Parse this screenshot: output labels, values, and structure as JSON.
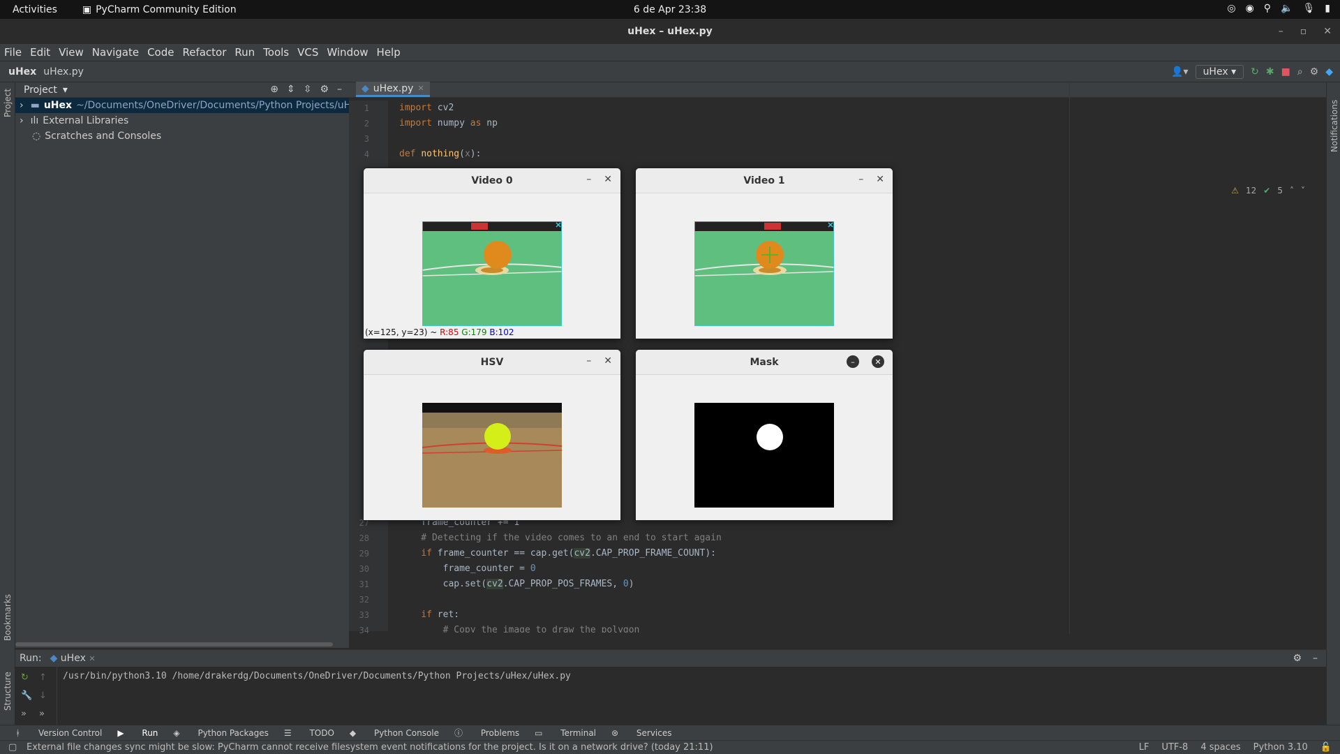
{
  "topbar": {
    "activities": "Activities",
    "app_name": "PyCharm Community Edition",
    "clock": "6 de Apr  23:38"
  },
  "window": {
    "title": "uHex – uHex.py"
  },
  "menu": [
    "File",
    "Edit",
    "View",
    "Navigate",
    "Code",
    "Refactor",
    "Run",
    "Tools",
    "VCS",
    "Window",
    "Help"
  ],
  "breadcrumb": {
    "project": "uHex",
    "file": "uHex.py"
  },
  "run_config": "uHex",
  "project_panel": {
    "title": "Project",
    "tree": [
      {
        "name": "uHex",
        "path": "~/Documents/OneDriver/Documents/Python Projects/uH"
      },
      {
        "name": "External Libraries"
      },
      {
        "name": "Scratches and Consoles"
      }
    ]
  },
  "editor": {
    "tab": "uHex.py",
    "inspections": {
      "warnings": "12",
      "ok": "5"
    },
    "line_numbers_top": [
      "1",
      "2",
      "3",
      "4"
    ],
    "line_numbers_bottom": [
      "27",
      "28",
      "29",
      "30",
      "31",
      "32",
      "33",
      "34"
    ],
    "code_top": [
      "import cv2",
      "import numpy as np",
      "",
      "def nothing(x):"
    ],
    "code_bottom": [
      "    frame_counter += 1",
      "    # Detecting if the video comes to an end to start again",
      "    if frame_counter == cap.get(cv2.CAP_PROP_FRAME_COUNT):",
      "        frame_counter = 0",
      "        cap.set(cv2.CAP_PROP_POS_FRAMES, 0)",
      "",
      "    if ret:",
      "        # Copy the image to draw the polygon"
    ]
  },
  "cv_windows": [
    {
      "title": "Video 0",
      "status": {
        "pos": "(x=125, y=23) ~ ",
        "r": "R:85",
        "g": "G:179",
        "b": "B:102"
      }
    },
    {
      "title": "Video 1"
    },
    {
      "title": "HSV"
    },
    {
      "title": "Mask"
    }
  ],
  "run_panel": {
    "label": "Run:",
    "tab": "uHex",
    "command": "/usr/bin/python3.10 /home/drakerdg/Documents/OneDriver/Documents/Python Projects/uHex/uHex.py"
  },
  "side_labels": {
    "project": "Project",
    "bookmarks": "Bookmarks",
    "structure": "Structure",
    "notifications": "Notifications"
  },
  "tool_windows": [
    "Version Control",
    "Run",
    "Python Packages",
    "TODO",
    "Python Console",
    "Problems",
    "Terminal",
    "Services"
  ],
  "status": {
    "message": "External file changes sync might be slow: PyCharm cannot receive filesystem event notifications for the project. Is it on a network drive? (today 21:11)",
    "lf": "LF",
    "encoding": "UTF-8",
    "indent": "4 spaces",
    "interpreter": "Python 3.10"
  },
  "colors": {
    "accent": "#4a88c7",
    "field_green": "#5fbf7f",
    "ball_orange": "#e08a1e",
    "hsv_bg": "#a88a5a",
    "hsv_ball": "#d4ee1a"
  }
}
